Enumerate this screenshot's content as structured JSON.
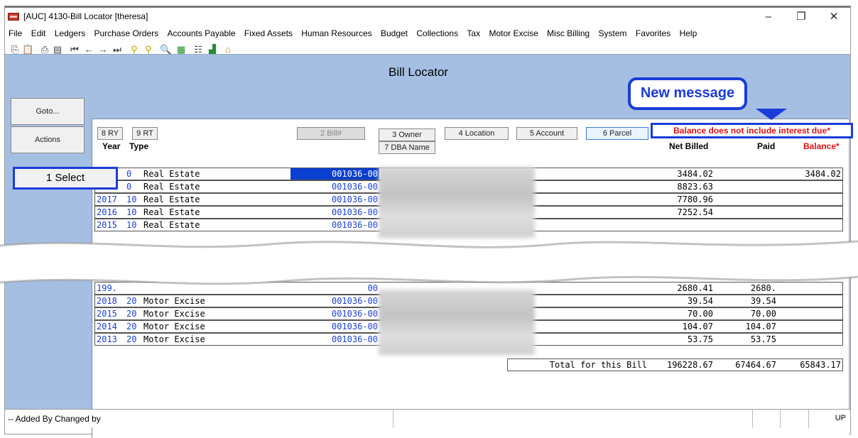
{
  "window": {
    "title": "[AUC] 4130-Bill Locator [theresa]"
  },
  "menu": [
    "File",
    "Edit",
    "Ledgers",
    "Purchase Orders",
    "Accounts Payable",
    "Fixed Assets",
    "Human Resources",
    "Budget",
    "Collections",
    "Tax",
    "Motor Excise",
    "Misc Billing",
    "System",
    "Favorites",
    "Help"
  ],
  "page_title": "Bill Locator",
  "side_buttons": {
    "goto": "Goto...",
    "actions": "Actions"
  },
  "header_buttons": {
    "ry": "8 RY",
    "rt": "9 RT",
    "bill": "2 Bill#",
    "owner": "3 Owner",
    "location": "4 Location",
    "account": "5 Account",
    "parcel": "6 Parcel",
    "dba": "7 DBA Name"
  },
  "columns": {
    "year": "Year",
    "type": "Type",
    "net_billed": "Net Billed",
    "paid": "Paid",
    "balance": "Balance*"
  },
  "callout": {
    "label": "New message",
    "message": "Balance does not include interest due*"
  },
  "select_button": "1 Select",
  "rows_top": [
    {
      "year": "",
      "code": "0",
      "type": "Real Estate",
      "bill": "001036-00",
      "net": "3484.02",
      "paid": "",
      "balance": "3484.02"
    },
    {
      "year": "",
      "code": "0",
      "type": "Real Estate",
      "bill": "001036-00",
      "net": "8823.63",
      "paid": "",
      "balance": ""
    },
    {
      "year": "2017",
      "code": "10",
      "type": "Real Estate",
      "bill": "001036-00",
      "net": "7780.96",
      "paid": "",
      "balance": ""
    },
    {
      "year": "2016",
      "code": "10",
      "type": "Real Estate",
      "bill": "001036-00",
      "net": "7252.54",
      "paid": "",
      "balance": ""
    },
    {
      "year": "2015",
      "code": "10",
      "type": "Real Estate",
      "bill": "001036-00",
      "net": "",
      "paid": "",
      "balance": ""
    }
  ],
  "rows_bottom": [
    {
      "year": "199.",
      "code": "",
      "type": "",
      "bill": "00",
      "net": "2680.41",
      "paid": "2680.",
      "balance": ""
    },
    {
      "year": "2018",
      "code": "20",
      "type": "Motor Excise",
      "bill": "001036-00",
      "net": "39.54",
      "paid": "39.54",
      "balance": ""
    },
    {
      "year": "2015",
      "code": "20",
      "type": "Motor Excise",
      "bill": "001036-00",
      "net": "70.00",
      "paid": "70.00",
      "balance": ""
    },
    {
      "year": "2014",
      "code": "20",
      "type": "Motor Excise",
      "bill": "001036-00",
      "net": "104.07",
      "paid": "104.07",
      "balance": ""
    },
    {
      "year": "2013",
      "code": "20",
      "type": "Motor Excise",
      "bill": "001036-00",
      "net": "53.75",
      "paid": "53.75",
      "balance": ""
    }
  ],
  "totals": {
    "label": "Total for this Bill",
    "net": "196228.67",
    "paid": "67464.67",
    "balance": "65843.17"
  },
  "status": {
    "text": "-- Added By Changed by",
    "mode": "UP"
  },
  "colors": {
    "client_bg": "#a5bfe2",
    "accent_blue": "#1a3cd8",
    "message_red": "#e01010",
    "link_blue": "#1b3fd6"
  }
}
